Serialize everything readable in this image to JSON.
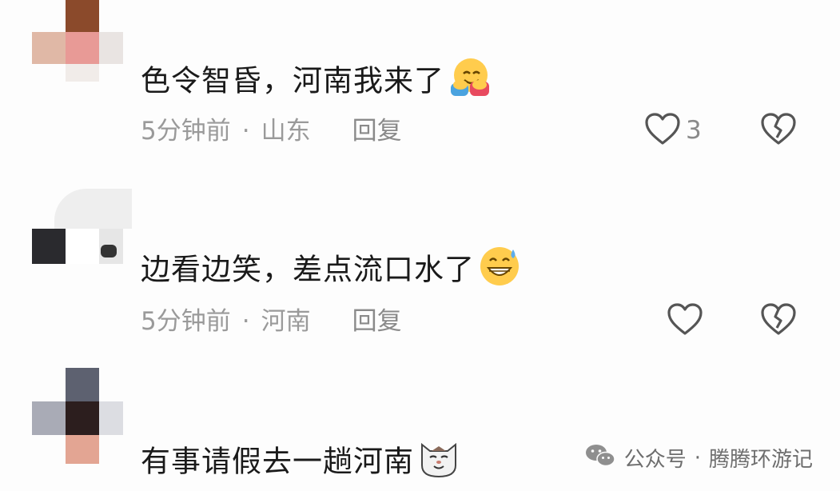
{
  "comments": [
    {
      "text": "色令智昏，河南我来了",
      "emoji": "hugging-face",
      "time": "5分钟前",
      "location": "山东",
      "reply_label": "回复",
      "likes": "3"
    },
    {
      "text": "边看边笑，差点流口水了",
      "emoji": "grinning-sweat-face",
      "time": "5分钟前",
      "location": "河南",
      "reply_label": "回复"
    },
    {
      "text": "有事请假去一趟河南",
      "emoji": "cat-face"
    }
  ],
  "meta_separator": "·",
  "watermark": {
    "prefix": "公众号",
    "separator": "·",
    "name": "腾腾环游记"
  }
}
